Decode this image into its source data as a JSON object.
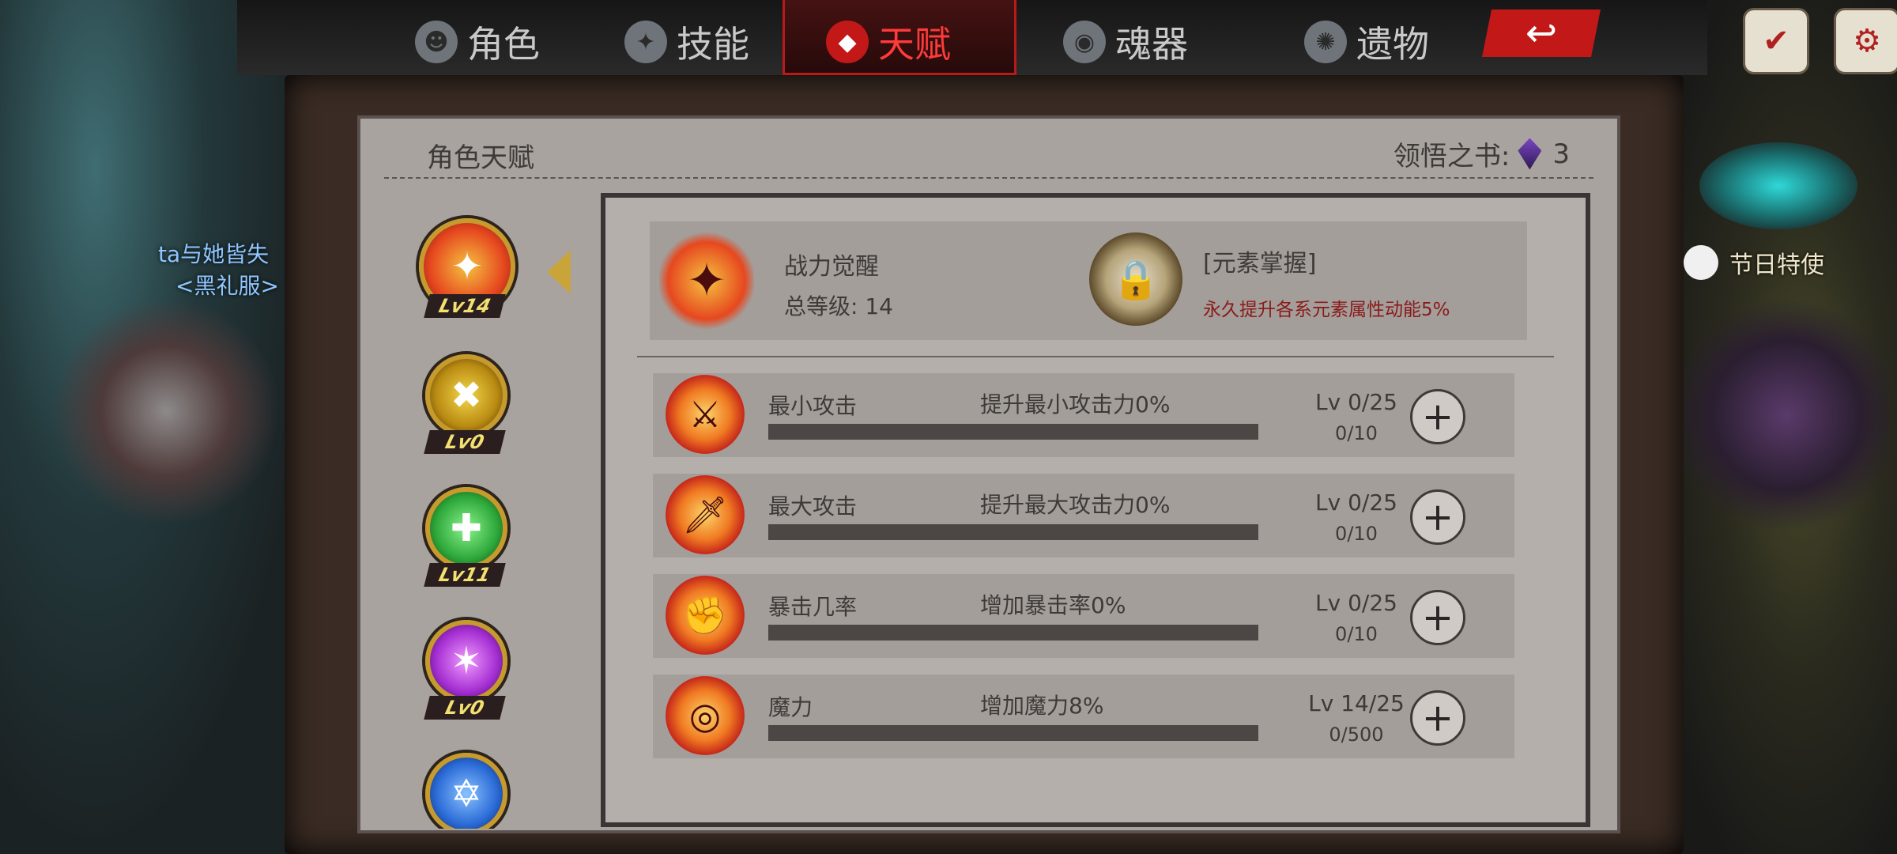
{
  "tabs": [
    {
      "label": "角色",
      "icon": "character-icon",
      "active": false
    },
    {
      "label": "技能",
      "icon": "skill-icon",
      "active": false
    },
    {
      "label": "天赋",
      "icon": "talent-icon",
      "active": true
    },
    {
      "label": "魂器",
      "icon": "soul-vessel-icon",
      "active": false
    },
    {
      "label": "遗物",
      "icon": "relic-icon",
      "active": false
    }
  ],
  "panel": {
    "title": "角色天赋",
    "book_label": "领悟之书:",
    "book_count": "3"
  },
  "character": {
    "name": "ta与她皆失",
    "outfit": "<黑礼服>"
  },
  "festival": {
    "label": "节日特使"
  },
  "side_talents": [
    {
      "level": "Lv14",
      "icon": "flame-sword-icon",
      "color": "#e6481f"
    },
    {
      "level": "Lv0",
      "icon": "shield-cross-icon",
      "color": "#d9b21f"
    },
    {
      "level": "Lv11",
      "icon": "heal-cross-icon",
      "color": "#35c44a"
    },
    {
      "level": "Lv0",
      "icon": "magic-star-icon",
      "color": "#b43bd6"
    },
    {
      "level": "",
      "icon": "blue-star-icon",
      "color": "#2a6ad6"
    }
  ],
  "awakening": {
    "title": "战力觉醒",
    "level_text": "总等级: 14",
    "element_title": "[元素掌握]",
    "element_desc": "永久提升各系元素属性动能5%"
  },
  "stats": [
    {
      "name": "最小攻击",
      "desc": "提升最小攻击力0%",
      "level": "Lv 0/25",
      "xp": "0/10",
      "progress": 0,
      "icon": "min-attack-icon"
    },
    {
      "name": "最大攻击",
      "desc": "提升最大攻击力0%",
      "level": "Lv 0/25",
      "xp": "0/10",
      "progress": 0,
      "icon": "max-attack-icon"
    },
    {
      "name": "暴击几率",
      "desc": "增加暴击率0%",
      "level": "Lv 0/25",
      "xp": "0/10",
      "progress": 0,
      "icon": "crit-icon"
    },
    {
      "name": "魔力",
      "desc": "增加魔力8%",
      "level": "Lv 14/25",
      "xp": "0/500",
      "progress": 0,
      "icon": "magic-icon"
    }
  ]
}
